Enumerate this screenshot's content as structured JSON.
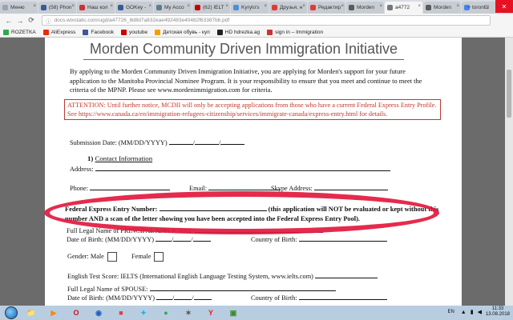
{
  "browser": {
    "tabs": [
      {
        "label": "Меню",
        "color": "#9aa4b0",
        "active": false
      },
      {
        "label": "(58) Phon",
        "color": "#3b5998",
        "active": false
      },
      {
        "label": "Наш кол",
        "color": "#cc3333",
        "active": false
      },
      {
        "label": "GOKey - ",
        "color": "#3b5998",
        "active": false
      },
      {
        "label": "My Acco",
        "color": "#607d8b",
        "active": false
      },
      {
        "label": "(62) IELT",
        "color": "#cc0000",
        "active": false
      },
      {
        "label": "Kyrylo's",
        "color": "#4a90d9",
        "active": false
      },
      {
        "label": "Друзья, н",
        "color": "#e53935",
        "active": false
      },
      {
        "label": "Редактир",
        "color": "#e53935",
        "active": false
      },
      {
        "label": "Morden",
        "color": "#5a5a5a",
        "active": false
      },
      {
        "label": "a4772",
        "color": "#777777",
        "active": true
      },
      {
        "label": "Morden",
        "color": "#5a5a5a",
        "active": false
      },
      {
        "label": "toronto",
        "color": "#4285f4",
        "active": false
      }
    ],
    "window_controls": [
      "–",
      "□",
      "✕"
    ],
    "back_label": "←",
    "forward_label": "→",
    "reload_label": "⟳",
    "address_url": "docs.wixstatic.com/ugd/a47726_8d8d7a832eae492483e40482f63387bb.pdf",
    "bookmarks": [
      {
        "label": "ROZETKA",
        "color": "#2fa84f"
      },
      {
        "label": "AliExpress",
        "color": "#e62e04"
      },
      {
        "label": "Facebook",
        "color": "#3b5998"
      },
      {
        "label": "youtube",
        "color": "#cc0000"
      },
      {
        "label": "Детская обувь - куп",
        "color": "#f0a000"
      },
      {
        "label": "HD hdrezka.ag",
        "color": "#222222"
      },
      {
        "label": "sign in – Immigration",
        "color": "#cc3333"
      }
    ]
  },
  "document": {
    "title": "Morden Community Driven Immigration Initiative",
    "intro": "By applying to the Morden Community Driven Immigration Initiative, you are applying for Morden's support for your future application to the Manitoba Provincial Nominee Program. It is your responsibility to ensure that you meet and continue to meet the criteria of the MPNP. Please see www.mordenimmigration.com for criteria.",
    "attention": "ATTENTION: Until further notice, MCDII will only be accepting applications from those who have a current Federal Express Entry Profile. See https://www.canada.ca/en/immigration-refugees-citizenship/services/immigrate-canada/express-entry.html for details.",
    "submission_date_label": "Submission Date: (MM/DD/YYYY)",
    "section_number": "1)",
    "section_heading": "Contact Information",
    "address_label": "Address:",
    "phone_label": "Phone:",
    "email_label": "Email:",
    "skype_label": "Skype Address:",
    "federal_label": "Federal Express Entry Number:",
    "federal_note": "(this application will NOT be evaluated or kept without this number AND a scan of the letter showing you have been accepted into the Federal Express Entry Pool).",
    "principal_name_label": "Full Legal Name of PRINCIPAL APPLICANT:",
    "dob_label": "Date of Birth: (MM/DD/YYYY)",
    "country_label": "Country of Birth:",
    "gender_label": "Gender:",
    "male_label": "Male",
    "female_label": "Female",
    "english_test_label": "English Test Score: IELTS (International English Language Testing System, www.ielts.com)",
    "spouse_name_label": "Full Legal Name of SPOUSE:",
    "spouse_dob_label": "Date of Birth: (MM/DD/YYYY)",
    "spouse_country_label": "Country of Birth:"
  },
  "annotation_color": "#e3193e",
  "taskbar": {
    "apps": [
      {
        "name": "explorer",
        "glyph": "📁",
        "color": "#f0c040"
      },
      {
        "name": "media",
        "glyph": "▶",
        "color": "#ff8800"
      },
      {
        "name": "opera",
        "glyph": "O",
        "color": "#cc0f16"
      },
      {
        "name": "app-blue",
        "glyph": "◉",
        "color": "#2060c0"
      },
      {
        "name": "app-red",
        "glyph": "■",
        "color": "#e04040"
      },
      {
        "name": "kodi",
        "glyph": "✦",
        "color": "#17b2e8"
      },
      {
        "name": "chrome",
        "glyph": "●",
        "color": "#34a853"
      },
      {
        "name": "app-star",
        "glyph": "✶",
        "color": "#555555"
      },
      {
        "name": "yandex",
        "glyph": "Y",
        "color": "#e02020"
      },
      {
        "name": "app-green",
        "glyph": "▣",
        "color": "#3a8a2a"
      }
    ],
    "language": "EN",
    "time": "11:33",
    "date": "13.08.2018"
  }
}
